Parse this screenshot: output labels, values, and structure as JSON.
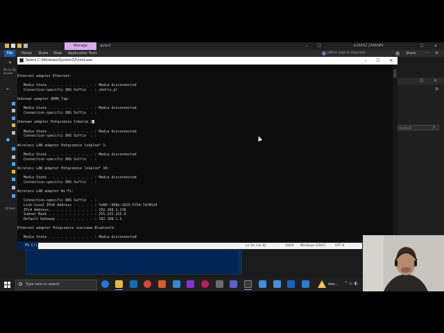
{
  "explorer": {
    "manage_tab": "Manage",
    "folder_name": "qutpvl",
    "user_name": "ŁUKASZ JURANEK",
    "ribbon_tabs": [
      "File",
      "Home",
      "Share",
      "View",
      "Application Tools"
    ],
    "offline_text": "offline (sign in required)",
    "share_btn": "Share",
    "pin_text": "Pin to Qu access",
    "items_text": "10 item"
  },
  "right_window": {
    "search_text": "kimBaz6"
  },
  "cmd": {
    "title": "Select C:\\Windows\\System32\\cmd.exe",
    "lines": [
      "Ethernet adapter Ethernet:",
      "",
      "   Media State . . . . . . . . . . . : Media disconnected",
      "   Connection-specific DNS Suffix  . : chello.pl",
      "",
      "Unknown adapter QEMU_Tap:",
      "",
      "   Media State . . . . . . . . . . . : Media disconnected",
      "   Connection-specific DNS Suffix  . :",
      "",
      "Unknown adapter Połączenie lokalne 2",
      "",
      "   Media State . . . . . . . . . . . : Media disconnected",
      "   Connection-specific DNS Suffix  . :",
      "",
      "Wireless LAN adapter Połączenie lokalne* 1:",
      "",
      "   Media State . . . . . . . . . . . : Media disconnected",
      "   Connection-specific DNS Suffix  . :",
      "",
      "Wireless LAN adapter Połączenie lokalne* 10:",
      "",
      "   Media State . . . . . . . . . . . : Media disconnected",
      "   Connection-specific DNS Suffix  . :",
      "",
      "Wireless LAN adapter Wi-Fi:",
      "",
      "   Connection-specific DNS Suffix  . :",
      "   Link-local IPv6 Address . . . . . : fe80::908e:1815:5f5d:7df8%14",
      "   IPv4 Address. . . . . . . . . . . : 192.168.1.110",
      "   Subnet Mask . . . . . . . . . . . : 255.255.255.0",
      "   Default Gateway . . . . . . . . . : 192.168.1.1",
      "",
      "Ethernet adapter Połączenie sieciowe Bluetooth:",
      "",
      "   Media State . . . . . . . . . . . : Media disconnected"
    ]
  },
  "notepad_status": {
    "position": "Ln 10, Col 42",
    "zoom": "100%",
    "line_ending": "Windows (CRLF)",
    "encoding": "UTF-8"
  },
  "powershell": {
    "prompt": "PS C:\\"
  },
  "taskbar": {
    "search_placeholder": "Type here to search",
    "alert_text": "Aler..."
  },
  "colors": {
    "cmd_bg": "#0c0c0c",
    "cmd_text": "#cccccc",
    "powershell_bg": "#012456",
    "manage_tab": "#d8a9ee",
    "taskbar_bg": "#202020"
  }
}
